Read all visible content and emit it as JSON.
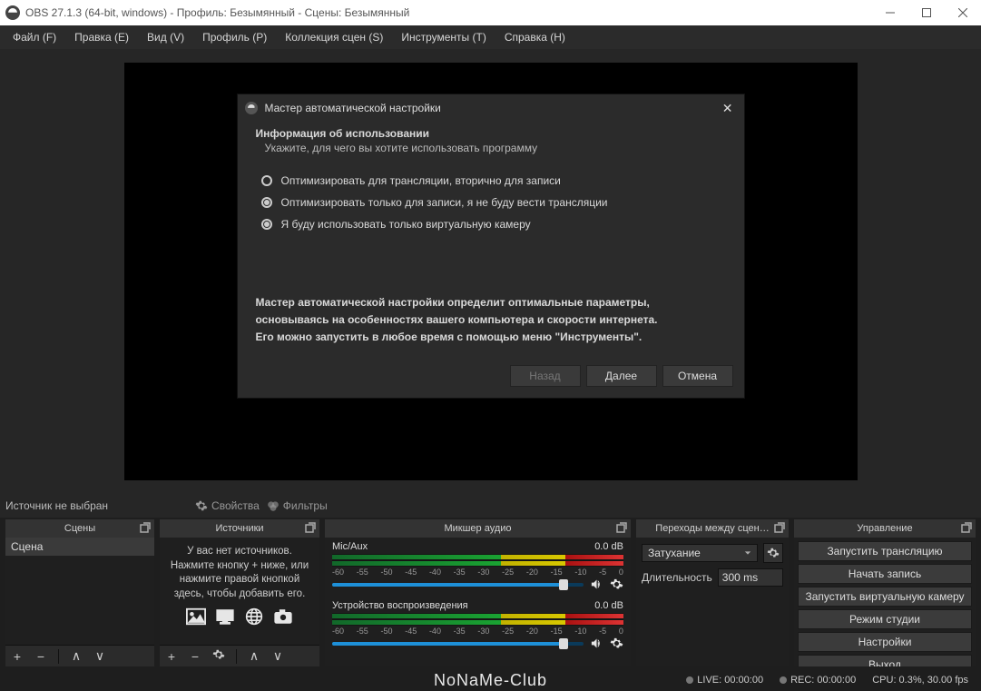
{
  "window": {
    "title": "OBS 27.1.3 (64-bit, windows) - Профиль: Безымянный - Сцены: Безымянный"
  },
  "menubar": [
    "Файл (F)",
    "Правка (E)",
    "Вид (V)",
    "Профиль (P)",
    "Коллекция сцен (S)",
    "Инструменты (T)",
    "Справка (H)"
  ],
  "wizard": {
    "title": "Мастер автоматической настройки",
    "heading": "Информация об использовании",
    "subtitle": "Укажите, для чего вы хотите использовать программу",
    "options": [
      "Оптимизировать для трансляции, вторично для записи",
      "Оптимизировать только для записи, я не буду вести трансляции",
      "Я буду использовать только виртуальную камеру"
    ],
    "info1": "Мастер автоматической настройки определит оптимальные параметры, основываясь на особенностях вашего компьютера и скорости интернета.",
    "info2": "Его можно запустить в любое время с помощью меню \"Инструменты\".",
    "buttons": {
      "back": "Назад",
      "next": "Далее",
      "cancel": "Отмена"
    }
  },
  "srcbar": {
    "none": "Источник не выбран",
    "props": "Свойства",
    "filters": "Фильтры"
  },
  "docks": {
    "scenes": {
      "title": "Сцены",
      "item": "Сцена"
    },
    "sources": {
      "title": "Источники",
      "empty": "У вас нет источников. Нажмите кнопку + ниже, или нажмите правой кнопкой здесь, чтобы добавить его."
    },
    "mixer": {
      "title": "Микшер аудио",
      "ch1": {
        "name": "Mic/Aux",
        "db": "0.0 dB"
      },
      "ch2": {
        "name": "Устройство воспроизведения",
        "db": "0.0 dB"
      },
      "ticks": [
        "-60",
        "-55",
        "-50",
        "-45",
        "-40",
        "-35",
        "-30",
        "-25",
        "-20",
        "-15",
        "-10",
        "-5",
        "0"
      ]
    },
    "trans": {
      "title": "Переходы между сцен…",
      "type": "Затухание",
      "dur_label": "Длительность",
      "dur_value": "300 ms"
    },
    "controls": {
      "title": "Управление",
      "buttons": [
        "Запустить трансляцию",
        "Начать запись",
        "Запустить виртуальную камеру",
        "Режим студии",
        "Настройки",
        "Выход"
      ]
    }
  },
  "status": {
    "watermark": "NoNaMe-Club",
    "live": "LIVE: 00:00:00",
    "rec": "REC: 00:00:00",
    "cpu": "CPU: 0.3%, 30.00 fps"
  }
}
